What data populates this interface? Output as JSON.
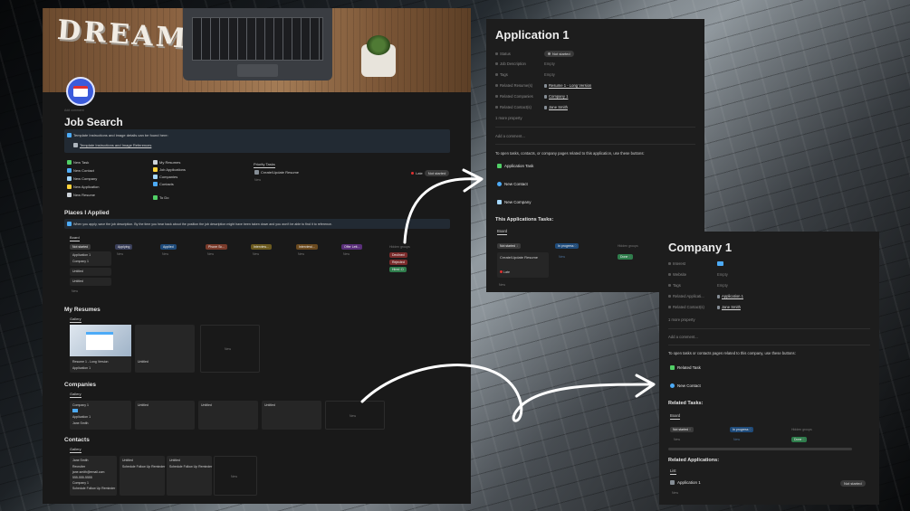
{
  "left": {
    "cover_word": "DREAM",
    "add_comment": "Add comment",
    "title": "Job Search",
    "callout_text": "Template Instructions and image details can be found here:",
    "callout_link": "Template Instructions and Image References",
    "quick_buttons": [
      "New Task",
      "New Contact",
      "New Company",
      "New Application",
      "New Resume"
    ],
    "nav_links": [
      "My Resumes",
      "Job Applications",
      "Companies",
      "Contacts"
    ],
    "todo": "To Do",
    "priority": {
      "tab": "Priority Tasks",
      "item": "Create/Update Resume",
      "late": "Late",
      "status": "Not started",
      "new": "New"
    },
    "places": {
      "heading": "Places I Applied",
      "callout": "When you apply, save the job description. By the time you hear back about the position the job description might have been taken down and you won't be able to find it to reference.",
      "tab": "Board",
      "columns": [
        "Not started",
        "Applying",
        "Applied",
        "Phone Sc...",
        "Interview...",
        "Interviewi...",
        "Offer Lett..."
      ],
      "hidden_groups": "Hidden groups",
      "hidden": [
        "Declined",
        "Rejected",
        "Hired :D"
      ],
      "card_title": "Application 1",
      "card_company": "Company 1",
      "untitled": "Untitled",
      "new": "New"
    },
    "resumes": {
      "heading": "My Resumes",
      "tab": "Gallery",
      "card_title": "Resume 1 - Long Version",
      "card_app": "Application 1",
      "untitled": "Untitled",
      "new": "New"
    },
    "companies": {
      "heading": "Companies",
      "tab": "Gallery",
      "card_title": "Company 1",
      "card_app": "Application 1",
      "card_contact": "Jane Smith",
      "untitled": "Untitled",
      "new": "New"
    },
    "contacts": {
      "heading": "Contacts",
      "tab": "Gallery",
      "card_title": "Jane Smith",
      "card_lines": [
        "Recruiter",
        "jane.smith@email.com",
        "555-555-5555",
        "Company 1",
        "Schedule Follow Up Reminder"
      ],
      "untitled": "Untitled",
      "reminder": "Schedule Follow Up Reminder",
      "new": "New"
    }
  },
  "application": {
    "title": "Application 1",
    "props": [
      {
        "name": "Status",
        "value": "Not started",
        "kind": "pill"
      },
      {
        "name": "Job Description",
        "value": "Empty",
        "kind": "empty"
      },
      {
        "name": "Tags",
        "value": "Empty",
        "kind": "empty"
      },
      {
        "name": "Related Resume(s)",
        "value": "Resume 1 - Long Version",
        "kind": "link"
      },
      {
        "name": "Related Companies",
        "value": "Company 1",
        "kind": "link"
      },
      {
        "name": "Related Contact(s)",
        "value": "Jane Smith",
        "kind": "link"
      }
    ],
    "more_property": "1 more property",
    "add_comment": "Add a comment...",
    "instructions": "To open tasks, contacts, or company pages related to this application, use these buttons:",
    "buttons": [
      "Application Task",
      "New Contact",
      "New Company"
    ],
    "tasks_heading": "This Applications Tasks:",
    "tasks_tab": "Board",
    "columns": [
      "Not started",
      "In progress"
    ],
    "col_counts": [
      "1",
      "0"
    ],
    "hidden_groups": "Hidden groups",
    "done": "Done",
    "done_count": "0",
    "task_card": "Create/Update Resume",
    "task_late": "Late",
    "new": "New"
  },
  "company": {
    "title": "Company 1",
    "props": [
      {
        "name": "Interest",
        "value": "",
        "kind": "icon"
      },
      {
        "name": "Website",
        "value": "Empty",
        "kind": "empty"
      },
      {
        "name": "Tags",
        "value": "Empty",
        "kind": "empty"
      },
      {
        "name": "Related Applicati...",
        "value": "Application 1",
        "kind": "link"
      },
      {
        "name": "Related Contact(s)",
        "value": "Jane Smith",
        "kind": "link"
      }
    ],
    "more_property": "1 more property",
    "add_comment": "Add a comment...",
    "instructions": "To open tasks or contacts pages related to this company, use these buttons:",
    "buttons": [
      "Related Task",
      "New Contact"
    ],
    "tasks_heading": "Related Tasks:",
    "tasks_tab": "Board",
    "columns": [
      "Not started",
      "In progress"
    ],
    "col_counts": [
      "0",
      "0"
    ],
    "hidden_groups": "Hidden groups",
    "done": "Done",
    "done_count": "0",
    "new": "New",
    "apps_heading": "Related Applications:",
    "apps_tab": "List",
    "app_item": "Application 1",
    "app_status": "Not started"
  },
  "colors": {
    "panel": "#191919",
    "accent_blue": "#3b5bdb",
    "late_red": "#e03131",
    "done_green": "#2f7d4c"
  }
}
